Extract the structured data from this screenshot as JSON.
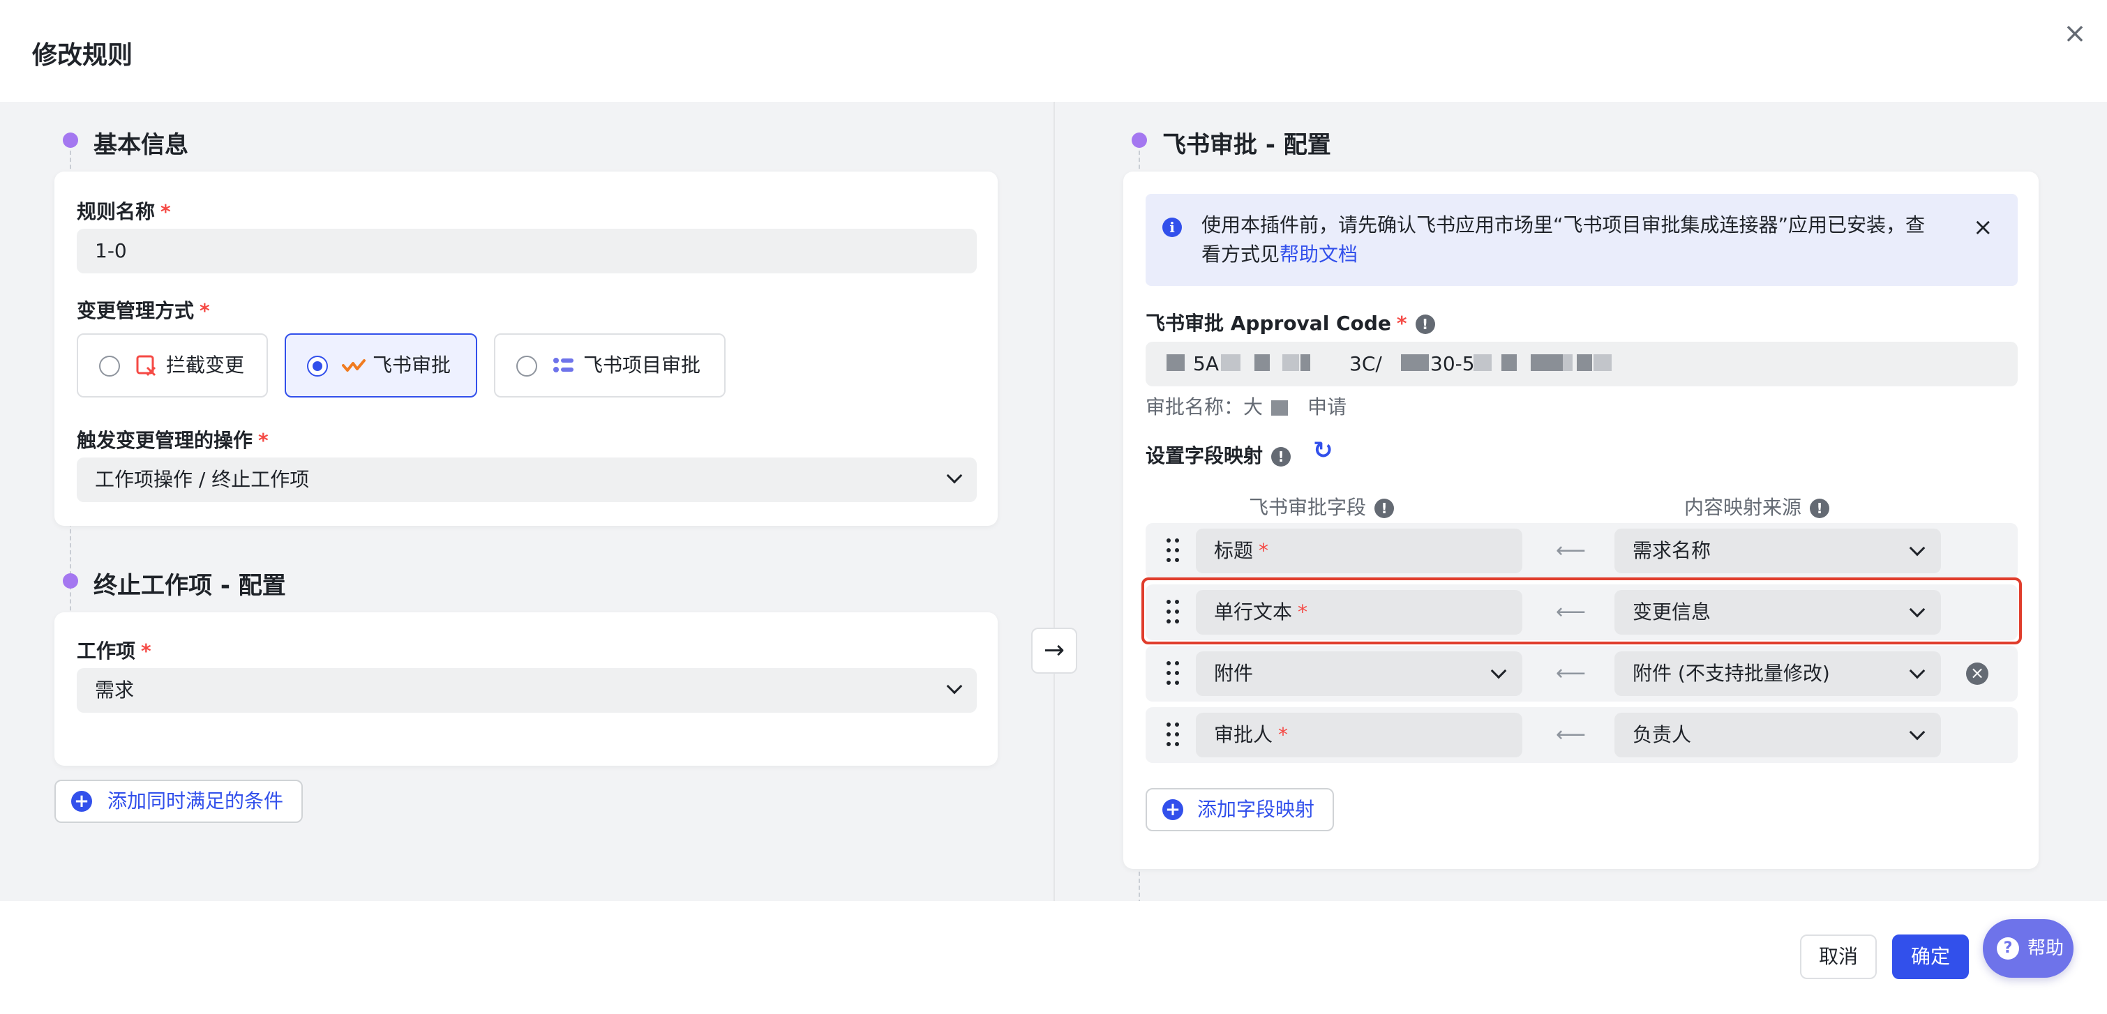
{
  "dialog": {
    "title": "修改规则",
    "close_symbol": "×"
  },
  "left": {
    "basic_section_title": "基本信息",
    "rule_name_label": "规则名称",
    "rule_name_value": "1-0",
    "mode_label": "变更管理方式",
    "mode_options": [
      {
        "label": "拦截变更",
        "icon": "intercept-icon",
        "selected": false
      },
      {
        "label": "飞书审批",
        "icon": "feishu-approval-icon",
        "selected": true
      },
      {
        "label": "飞书项目审批",
        "icon": "project-approval-icon",
        "selected": false
      }
    ],
    "trigger_label": "触发变更管理的操作",
    "trigger_value": "工作项操作 / 终止工作项",
    "terminate_section_title": "终止工作项 - 配置",
    "work_item_label": "工作项",
    "work_item_value": "需求",
    "add_condition_label": "添加同时满足的条件",
    "required_mark": "*"
  },
  "right": {
    "section_title": "飞书审批 - 配置",
    "info_text": "使用本插件前，请先确认飞书应用市场里“飞书项目审批集成连接器”应用已安装，查看方式见",
    "info_link": "帮助文档",
    "approval_code_label": "飞书审批 Approval Code",
    "approval_code_fragments": [
      "5A·",
      "3C/",
      "30-5"
    ],
    "approval_name_prefix": "审批名称：大",
    "approval_name_suffix": "申请",
    "mapping_label": "设置字段映射",
    "col_field": "飞书审批字段",
    "col_source": "内容映射来源",
    "rows": [
      {
        "field": "标题",
        "required": true,
        "source": "需求名称",
        "field_dropdown": false,
        "removable": false
      },
      {
        "field": "单行文本",
        "required": true,
        "source": "变更信息",
        "field_dropdown": false,
        "removable": false
      },
      {
        "field": "附件",
        "required": false,
        "source": "附件 (不支持批量修改)",
        "field_dropdown": true,
        "removable": true
      },
      {
        "field": "审批人",
        "required": true,
        "source": "负责人",
        "field_dropdown": false,
        "removable": false
      }
    ],
    "add_mapping_label": "添加字段映射"
  },
  "footer": {
    "cancel_label": "取消",
    "ok_label": "确定",
    "help_label": "帮助"
  },
  "colors": {
    "accent": "#3250eb",
    "section_dot": "#a477f0",
    "required": "#f54a45",
    "highlight_border": "#e03d2c",
    "help_button": "#6e73ea"
  }
}
